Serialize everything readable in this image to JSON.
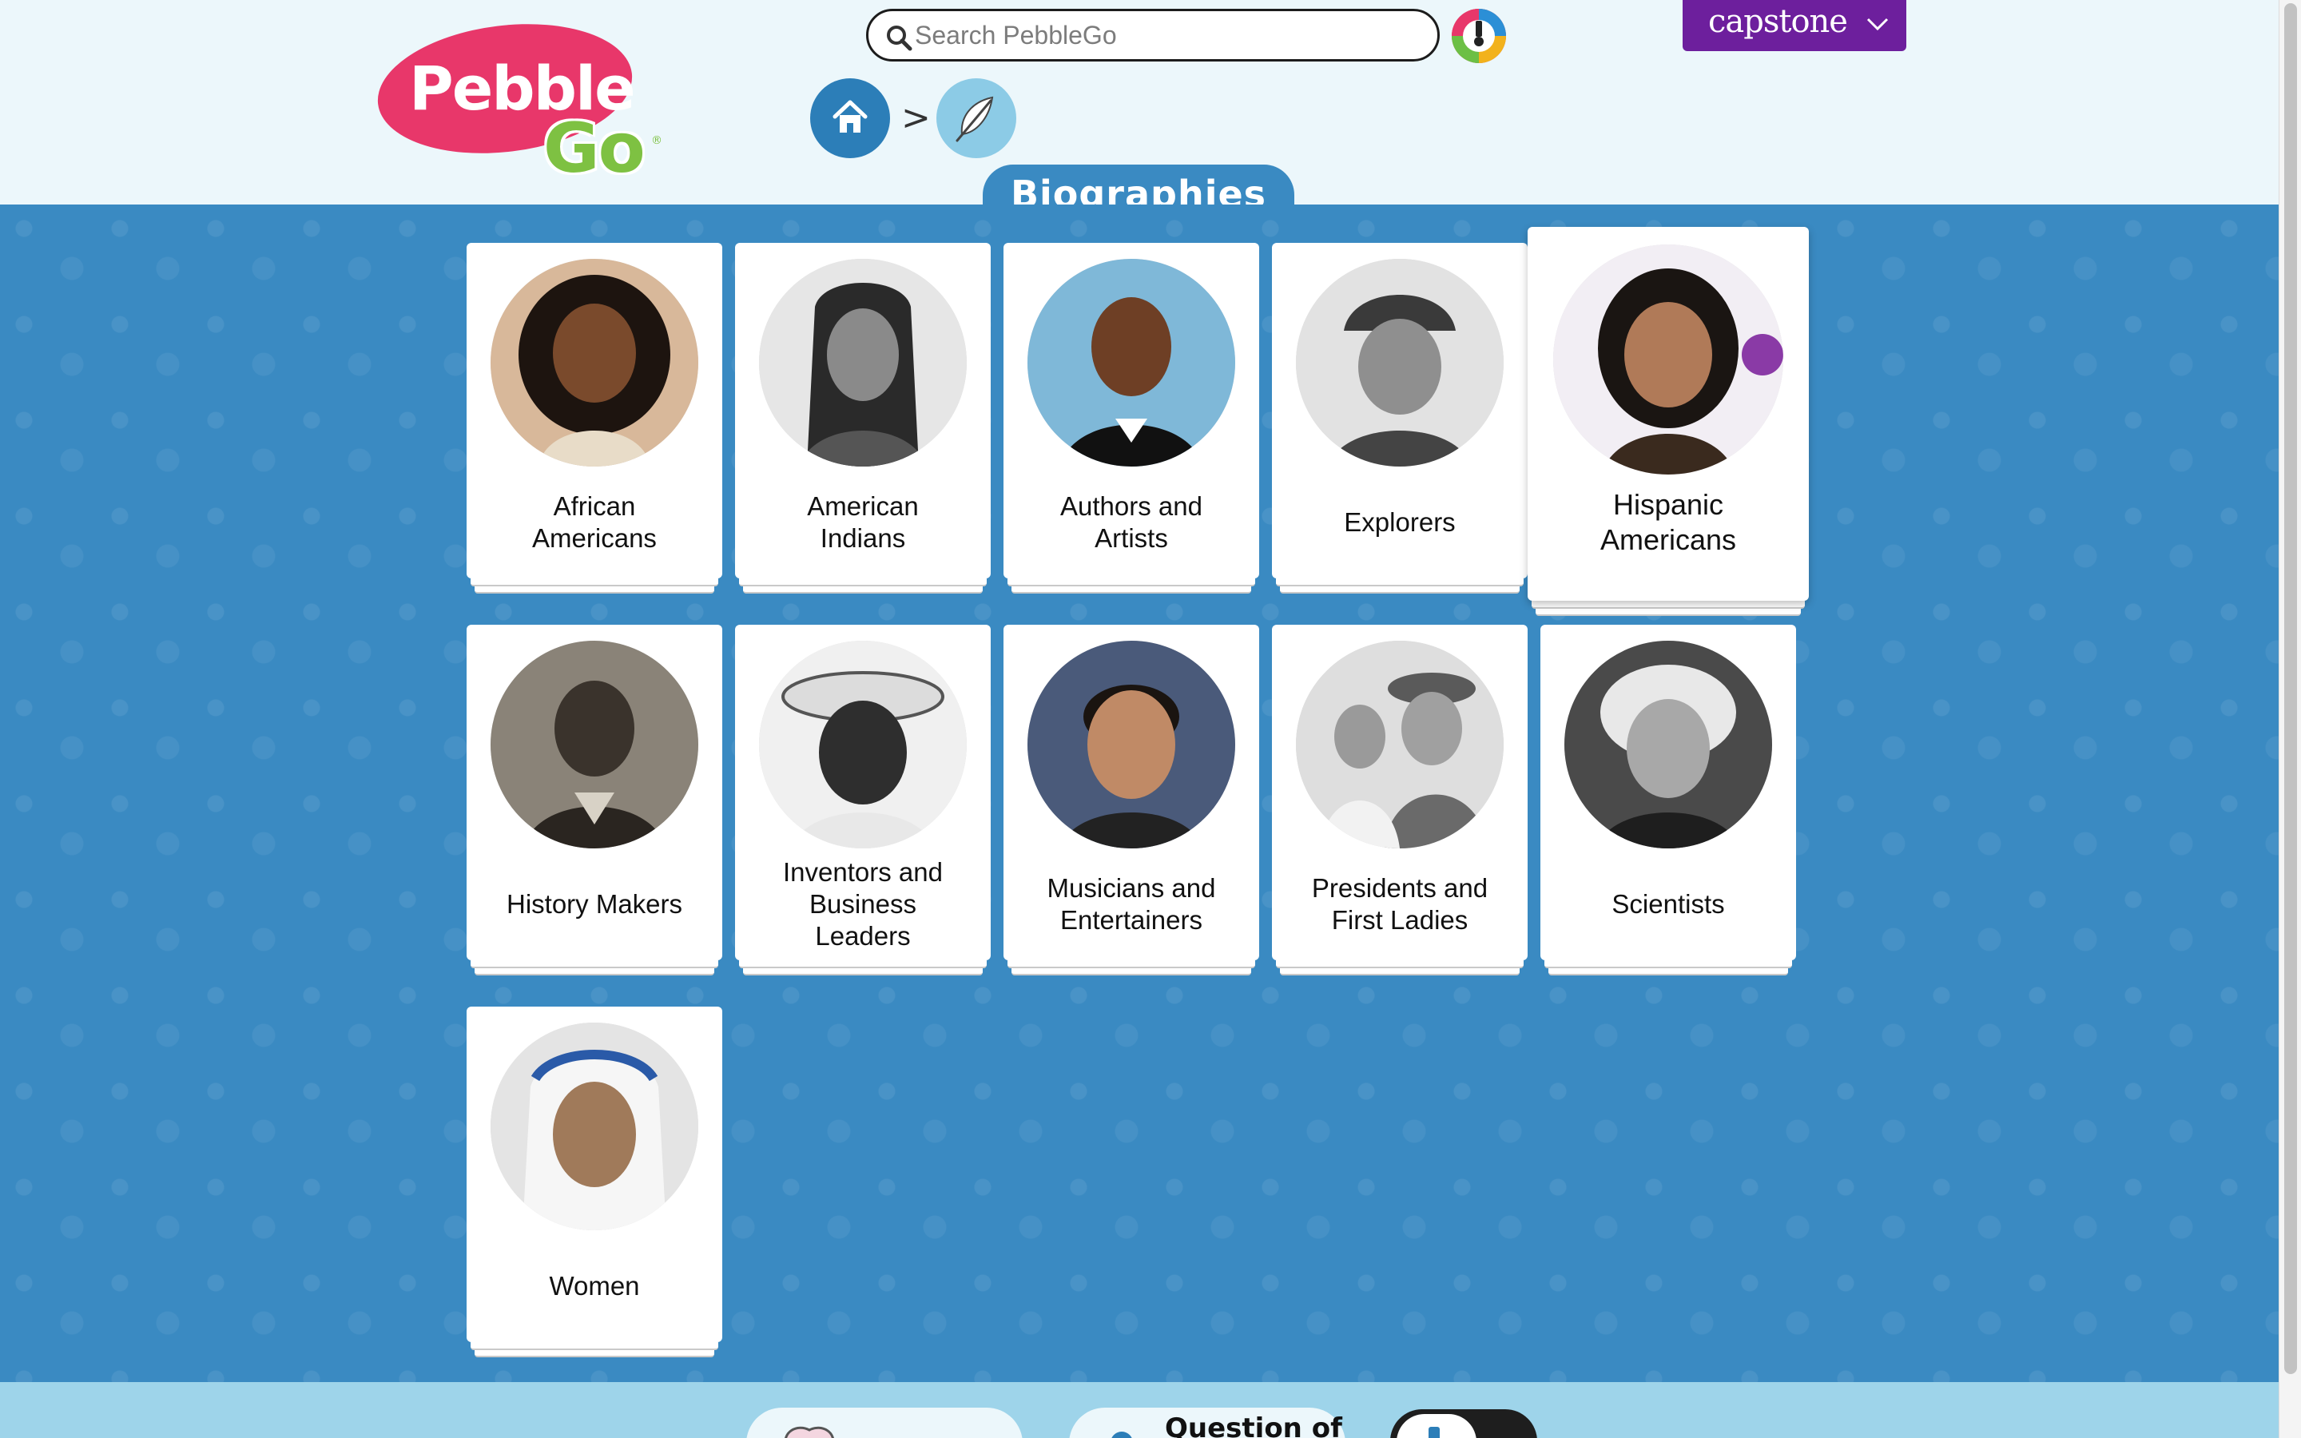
{
  "header": {
    "logo": {
      "word1": "Pebble",
      "word2": "Go",
      "mark": "®",
      "icon": "pebblego-logo"
    },
    "search": {
      "placeholder": "Search PebbleGo",
      "value": "",
      "icon": "search-icon"
    },
    "wheel_icon": "color-wheel-icon",
    "capstone": {
      "label": "capstone",
      "icon": "chevron-down-icon",
      "color": "#6d1f9d"
    },
    "breadcrumb": {
      "home_icon": "home-icon",
      "separator": ">",
      "current_icon": "feather-icon"
    },
    "title": "Biographies"
  },
  "colors": {
    "page_background": "#3a8ac2",
    "header_background": "#ecf7fb",
    "footer_background": "#9ed4ea",
    "title_tab": "#3a8ac2",
    "home_button": "#2c7eb8",
    "feather_button": "#8ccbe6"
  },
  "categories": [
    {
      "label": "African\nAmericans",
      "icon": "portrait-photo"
    },
    {
      "label": "American\nIndians",
      "icon": "portrait-photo"
    },
    {
      "label": "Authors and\nArtists",
      "icon": "portrait-photo"
    },
    {
      "label": "Explorers",
      "icon": "portrait-photo"
    },
    {
      "label": "Hispanic\nAmericans",
      "icon": "portrait-photo",
      "state": "hovered"
    },
    {
      "label": "History Makers",
      "icon": "portrait-photo"
    },
    {
      "label": "Inventors and\nBusiness\nLeaders",
      "icon": "portrait-photo"
    },
    {
      "label": "Musicians and\nEntertainers",
      "icon": "portrait-photo"
    },
    {
      "label": "Presidents and\nFirst Ladies",
      "icon": "portrait-photo"
    },
    {
      "label": "Scientists",
      "icon": "portrait-photo"
    },
    {
      "label": "Women",
      "icon": "portrait-photo"
    }
  ],
  "footer": {
    "question_label": "Question of",
    "items": [
      "brain-icon",
      "question-of-the-day-icon",
      "audio-toggle"
    ]
  }
}
